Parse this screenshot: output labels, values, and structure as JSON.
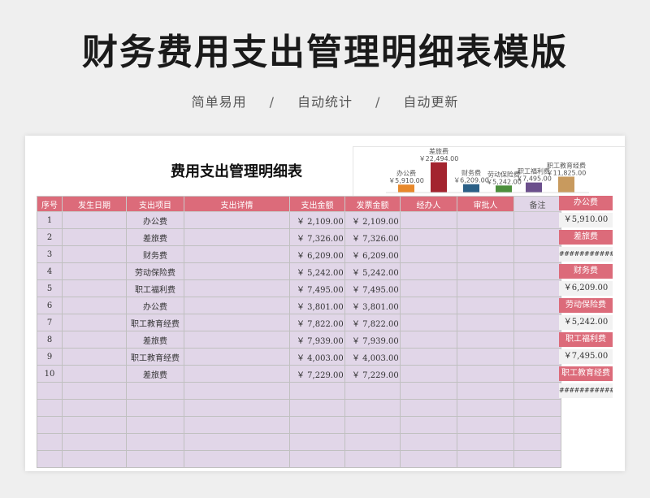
{
  "hero": {
    "title": "财务费用支出管理明细表模版",
    "features": [
      "简单易用",
      "自动统计",
      "自动更新"
    ],
    "separator": "/"
  },
  "sheet": {
    "title": "费用支出管理明细表",
    "headers": [
      "序号",
      "发生日期",
      "支出项目",
      "支出详情",
      "支出金额",
      "发票金额",
      "经办人",
      "审批人",
      "备注"
    ],
    "rows": [
      {
        "no": "1",
        "date": "",
        "item": "办公费",
        "detail": "",
        "amount": "￥ 2,109.00",
        "invoice": "￥ 2,109.00",
        "handler": "",
        "approver": "",
        "remark": ""
      },
      {
        "no": "2",
        "date": "",
        "item": "差旅费",
        "detail": "",
        "amount": "￥ 7,326.00",
        "invoice": "￥ 7,326.00",
        "handler": "",
        "approver": "",
        "remark": ""
      },
      {
        "no": "3",
        "date": "",
        "item": "财务费",
        "detail": "",
        "amount": "￥ 6,209.00",
        "invoice": "￥ 6,209.00",
        "handler": "",
        "approver": "",
        "remark": ""
      },
      {
        "no": "4",
        "date": "",
        "item": "劳动保险费",
        "detail": "",
        "amount": "￥ 5,242.00",
        "invoice": "￥ 5,242.00",
        "handler": "",
        "approver": "",
        "remark": ""
      },
      {
        "no": "5",
        "date": "",
        "item": "职工福利费",
        "detail": "",
        "amount": "￥ 7,495.00",
        "invoice": "￥ 7,495.00",
        "handler": "",
        "approver": "",
        "remark": ""
      },
      {
        "no": "6",
        "date": "",
        "item": "办公费",
        "detail": "",
        "amount": "￥ 3,801.00",
        "invoice": "￥ 3,801.00",
        "handler": "",
        "approver": "",
        "remark": ""
      },
      {
        "no": "7",
        "date": "",
        "item": "职工教育经费",
        "detail": "",
        "amount": "￥ 7,822.00",
        "invoice": "￥ 7,822.00",
        "handler": "",
        "approver": "",
        "remark": ""
      },
      {
        "no": "8",
        "date": "",
        "item": "差旅费",
        "detail": "",
        "amount": "￥ 7,939.00",
        "invoice": "￥ 7,939.00",
        "handler": "",
        "approver": "",
        "remark": ""
      },
      {
        "no": "9",
        "date": "",
        "item": "职工教育经费",
        "detail": "",
        "amount": "￥ 4,003.00",
        "invoice": "￥ 4,003.00",
        "handler": "",
        "approver": "",
        "remark": ""
      },
      {
        "no": "10",
        "date": "",
        "item": "差旅费",
        "detail": "",
        "amount": "￥ 7,229.00",
        "invoice": "￥ 7,229.00",
        "handler": "",
        "approver": "",
        "remark": ""
      },
      {
        "no": "",
        "date": "",
        "item": "",
        "detail": "",
        "amount": "",
        "invoice": "",
        "handler": "",
        "approver": "",
        "remark": ""
      },
      {
        "no": "",
        "date": "",
        "item": "",
        "detail": "",
        "amount": "",
        "invoice": "",
        "handler": "",
        "approver": "",
        "remark": ""
      },
      {
        "no": "",
        "date": "",
        "item": "",
        "detail": "",
        "amount": "",
        "invoice": "",
        "handler": "",
        "approver": "",
        "remark": ""
      },
      {
        "no": "",
        "date": "",
        "item": "",
        "detail": "",
        "amount": "",
        "invoice": "",
        "handler": "",
        "approver": "",
        "remark": ""
      },
      {
        "no": "",
        "date": "",
        "item": "",
        "detail": "",
        "amount": "",
        "invoice": "",
        "handler": "",
        "approver": "",
        "remark": ""
      }
    ]
  },
  "summary": {
    "cells": [
      {
        "text": "办公费",
        "style": "hdr"
      },
      {
        "text": "￥5,910.00",
        "style": "val"
      },
      {
        "text": "差旅费",
        "style": "pink"
      },
      {
        "text": "############",
        "style": "hash"
      },
      {
        "text": "财务费",
        "style": "pink"
      },
      {
        "text": "￥6,209.00",
        "style": "val"
      },
      {
        "text": "劳动保险费",
        "style": "pink"
      },
      {
        "text": "￥5,242.00",
        "style": "val"
      },
      {
        "text": "职工福利费",
        "style": "pink"
      },
      {
        "text": "￥7,495.00",
        "style": "val"
      },
      {
        "text": "职工教育经费",
        "style": "pink"
      },
      {
        "text": "############",
        "style": "hash"
      }
    ]
  },
  "chart_data": {
    "type": "bar",
    "categories": [
      "办公费",
      "差旅费",
      "财务费",
      "劳动保险费",
      "职工福利费",
      "职工教育经费"
    ],
    "values": [
      5910,
      22494,
      6209,
      5242,
      7495,
      11825
    ],
    "value_labels": [
      "￥5,910.00",
      "￥22,494.00",
      "￥6,209.00",
      "￥5,242.00",
      "￥7,495.00",
      "￥11,825.00"
    ],
    "colors": [
      "#e8892b",
      "#a3242f",
      "#2a5f86",
      "#4c8f3c",
      "#6b4f8c",
      "#c89a5e"
    ],
    "title": "",
    "xlabel": "",
    "ylabel": "",
    "ylim": [
      0,
      23000
    ],
    "grid": false,
    "legend": "none"
  }
}
